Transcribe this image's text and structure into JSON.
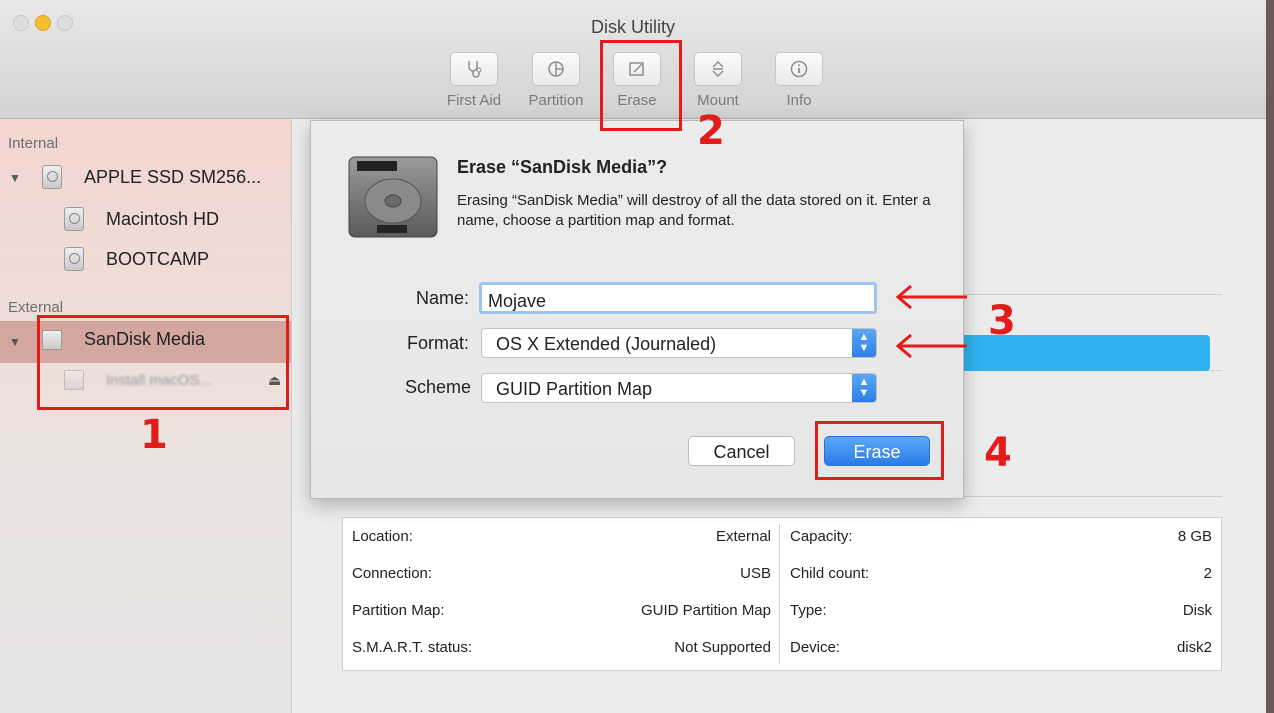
{
  "window": {
    "title": "Disk Utility"
  },
  "toolbar": [
    {
      "label": "First Aid",
      "icon": "stethoscope-icon"
    },
    {
      "label": "Partition",
      "icon": "pie-icon"
    },
    {
      "label": "Erase",
      "icon": "pencil-icon"
    },
    {
      "label": "Mount",
      "icon": "mount-icon"
    },
    {
      "label": "Info",
      "icon": "info-icon"
    }
  ],
  "sidebar": {
    "internal_label": "Internal",
    "external_label": "External",
    "items": [
      {
        "label": "APPLE SSD SM256..."
      },
      {
        "label": "Macintosh HD"
      },
      {
        "label": "BOOTCAMP"
      },
      {
        "label": "SanDisk Media"
      },
      {
        "label": "Install macOS..."
      }
    ]
  },
  "dialog": {
    "title": "Erase “SanDisk Media”?",
    "body": "Erasing “SanDisk Media” will destroy of all the data stored on it. Enter a name, choose a partition map and format.",
    "name_label": "Name:",
    "name_value": "Mojave",
    "format_label": "Format:",
    "format_value": "OS X Extended (Journaled)",
    "scheme_label": "Scheme",
    "scheme_value": "GUID Partition Map",
    "cancel_label": "Cancel",
    "erase_label": "Erase"
  },
  "info": {
    "rows": [
      {
        "k1": "Location:",
        "v1": "External",
        "k2": "Capacity:",
        "v2": "8 GB"
      },
      {
        "k1": "Connection:",
        "v1": "USB",
        "k2": "Child count:",
        "v2": "2"
      },
      {
        "k1": "Partition Map:",
        "v1": "GUID Partition Map",
        "k2": "Type:",
        "v2": "Disk"
      },
      {
        "k1": "S.M.A.R.T. status:",
        "v1": "Not Supported",
        "k2": "Device:",
        "v2": "disk2"
      }
    ]
  },
  "annotations": {
    "n1": "1",
    "n2": "2",
    "n3": "3",
    "n4": "4"
  },
  "colors": {
    "annotation": "#e41b1b",
    "accent": "#2f7fe8"
  }
}
